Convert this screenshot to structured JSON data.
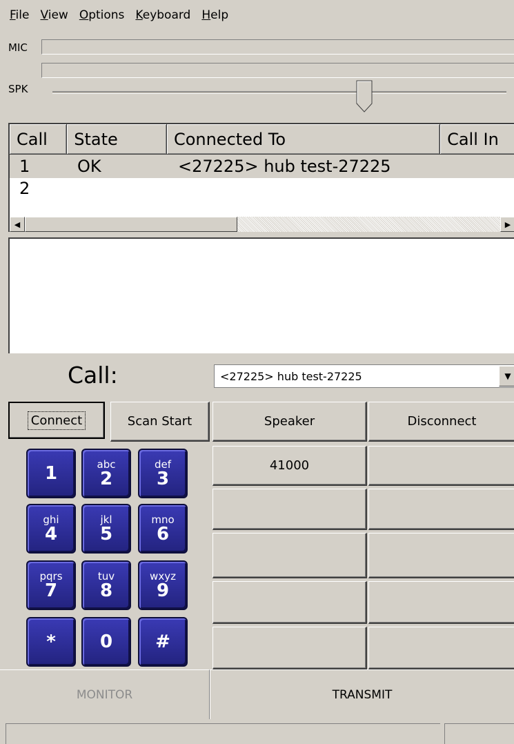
{
  "menu": [
    {
      "acc": "F",
      "rest": "ile"
    },
    {
      "acc": "V",
      "rest": "iew"
    },
    {
      "acc": "O",
      "rest": "ptions"
    },
    {
      "acc": "K",
      "rest": "eyboard"
    },
    {
      "acc": "H",
      "rest": "elp"
    }
  ],
  "meters": {
    "mic_label": "MIC",
    "spk_label": "SPK"
  },
  "calls": {
    "headers": [
      "Call",
      "State",
      "Connected To",
      "Call In"
    ],
    "rows": [
      {
        "call": "1",
        "state": "OK",
        "connected_to": "<27225> hub test-27225"
      },
      {
        "call": "2",
        "state": "",
        "connected_to": ""
      }
    ]
  },
  "call_select": {
    "label": "Call:",
    "value": "<27225> hub test-27225"
  },
  "buttons": {
    "connect": "Connect",
    "scan_start": "Scan Start",
    "speaker": "Speaker",
    "disconnect": "Disconnect",
    "preset_1": "41000",
    "monitor": "MONITOR",
    "transmit": "TRANSMIT"
  },
  "keypad": [
    {
      "sub": "",
      "main": "1"
    },
    {
      "sub": "abc",
      "main": "2"
    },
    {
      "sub": "def",
      "main": "3"
    },
    {
      "sub": "ghi",
      "main": "4"
    },
    {
      "sub": "jkl",
      "main": "5"
    },
    {
      "sub": "mno",
      "main": "6"
    },
    {
      "sub": "pqrs",
      "main": "7"
    },
    {
      "sub": "tuv",
      "main": "8"
    },
    {
      "sub": "wxyz",
      "main": "9"
    },
    {
      "sub": "",
      "main": "*"
    },
    {
      "sub": "",
      "main": "0"
    },
    {
      "sub": "",
      "main": "#"
    }
  ]
}
